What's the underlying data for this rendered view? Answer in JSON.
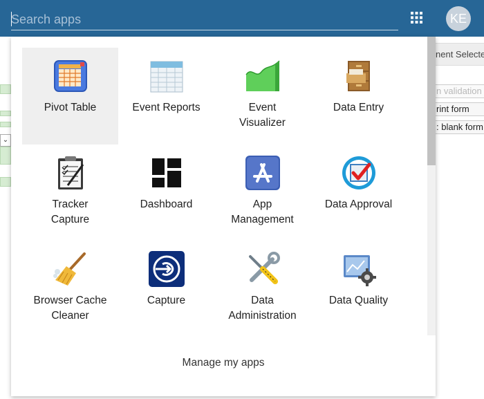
{
  "header": {
    "search_placeholder": "Search apps",
    "search_value": "",
    "apps_menu_icon": "apps-grid-icon",
    "avatar_initials": "KE",
    "bar_color": "#276696"
  },
  "background": {
    "panel_text": "nent Selecte",
    "buttons": [
      {
        "label": "n validation",
        "disabled": true
      },
      {
        "label": "rint form",
        "disabled": false
      },
      {
        "label": ": blank form",
        "disabled": false
      }
    ]
  },
  "apps": [
    {
      "label": "Pivot Table",
      "icon": "pivot-table-icon"
    },
    {
      "label": "Event Reports",
      "icon": "event-reports-icon"
    },
    {
      "label": "Event\nVisualizer",
      "icon": "event-visualizer-icon"
    },
    {
      "label": "Data Entry",
      "icon": "data-entry-icon"
    },
    {
      "label": "Tracker\nCapture",
      "icon": "tracker-capture-icon"
    },
    {
      "label": "Dashboard",
      "icon": "dashboard-icon"
    },
    {
      "label": "App\nManagement",
      "icon": "app-management-icon"
    },
    {
      "label": "Data Approval",
      "icon": "data-approval-icon"
    },
    {
      "label": "Browser Cache\nCleaner",
      "icon": "browser-cache-cleaner-icon"
    },
    {
      "label": "Capture",
      "icon": "capture-icon"
    },
    {
      "label": "Data\nAdministration",
      "icon": "data-administration-icon"
    },
    {
      "label": "Data Quality",
      "icon": "data-quality-icon"
    }
  ],
  "footer": {
    "manage_label": "Manage my apps"
  }
}
